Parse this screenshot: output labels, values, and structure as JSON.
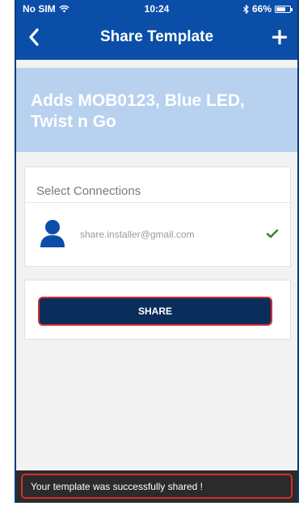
{
  "status_bar": {
    "carrier": "No SIM",
    "time": "10:24",
    "battery_percent": "66%",
    "battery_level": 0.66,
    "icons": [
      "wifi-icon",
      "bluetooth-icon",
      "battery-icon"
    ]
  },
  "navbar": {
    "title": "Share Template",
    "back_icon": "chevron-left-icon",
    "add_icon": "plus-icon"
  },
  "template": {
    "name": "Adds MOB0123, Blue LED, Twist n Go"
  },
  "connections": {
    "section_title": "Select Connections",
    "items": [
      {
        "email": "share.installer@gmail.com",
        "selected": true
      }
    ]
  },
  "share": {
    "button_label": "SHARE"
  },
  "toast": {
    "message": "Your template was successfully shared !"
  },
  "colors": {
    "primary": "#0b4ea8",
    "banner": "#b7d1ef",
    "button": "#0a2d5c",
    "highlight": "#d32f2f",
    "check": "#2e8b3a"
  }
}
